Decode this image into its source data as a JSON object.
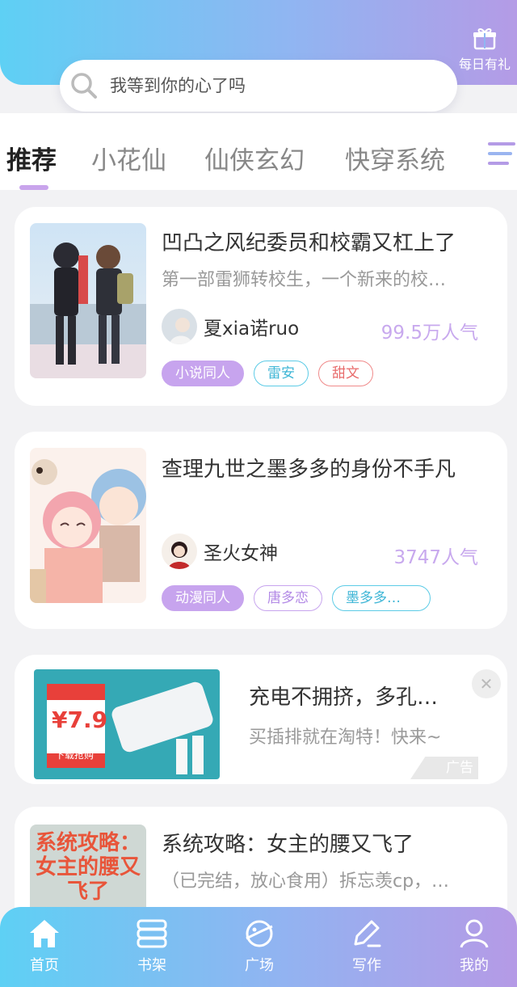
{
  "header": {
    "gift_label": "每日有礼",
    "search_placeholder": "我等到你的心了吗"
  },
  "tabs": [
    {
      "label": "推荐",
      "active": true
    },
    {
      "label": "小花仙",
      "active": false
    },
    {
      "label": "仙侠玄幻",
      "active": false
    },
    {
      "label": "快穿系统",
      "active": false
    }
  ],
  "books": [
    {
      "title": "凹凸之风纪委员和校霸又杠上了",
      "desc": "第一部雷狮转校生，一个新来的校…",
      "author": "夏xia诺ruo",
      "popularity": "99.5万人气",
      "tags": [
        "小说同人",
        "雷安",
        "甜文"
      ]
    },
    {
      "title": "查理九世之墨多多的身份不手凡",
      "desc": "",
      "author": "圣火女神",
      "popularity": "3747人气",
      "tags": [
        "动漫同人",
        "唐多恋",
        "墨多多…"
      ]
    },
    {
      "title": "系统攻略：女主的腰又飞了",
      "desc": "（已完结，放心食用）拆忘羡cp，…"
    }
  ],
  "ad": {
    "title": "充电不拥挤，多孔…",
    "desc": "买插排就在淘特！快来~",
    "badge": "广告",
    "close": "✕",
    "price": "¥7.9",
    "cta": "下载抢购"
  },
  "cover3_text": "系统攻略：女主的腰又飞了",
  "nav": [
    {
      "label": "首页",
      "icon": "home-icon"
    },
    {
      "label": "书架",
      "icon": "bookshelf-icon"
    },
    {
      "label": "广场",
      "icon": "planet-icon"
    },
    {
      "label": "写作",
      "icon": "pen-icon"
    },
    {
      "label": "我的",
      "icon": "user-icon"
    }
  ],
  "colors": {
    "accent_purple": "#c7a4ee",
    "header_start": "#5ed0f4",
    "header_end": "#b49be6"
  }
}
